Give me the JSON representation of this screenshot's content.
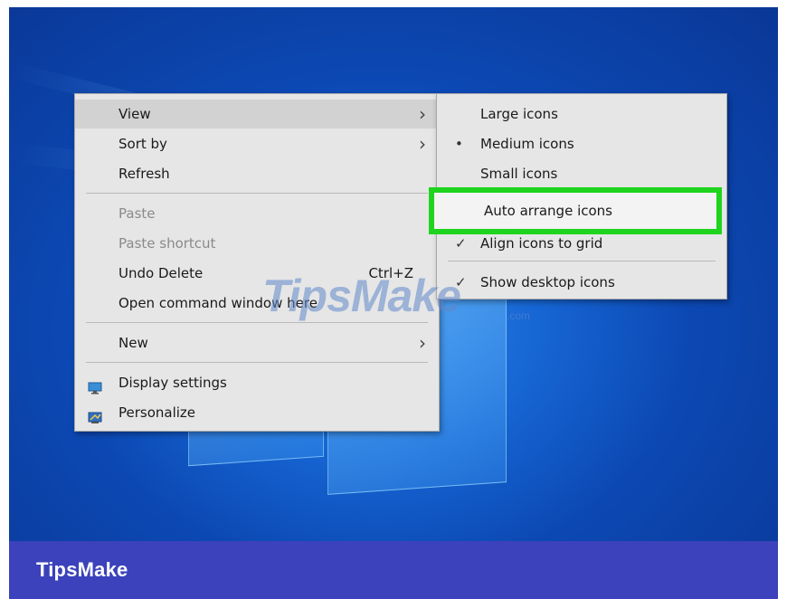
{
  "context_menu": {
    "items": [
      {
        "label": "View"
      },
      {
        "label": "Sort by"
      },
      {
        "label": "Refresh"
      },
      {
        "label": "Paste"
      },
      {
        "label": "Paste shortcut"
      },
      {
        "label": "Undo Delete",
        "shortcut": "Ctrl+Z"
      },
      {
        "label": "Open command window here"
      },
      {
        "label": "New"
      },
      {
        "label": "Display settings",
        "icon": "display-settings-icon"
      },
      {
        "label": "Personalize",
        "icon": "personalize-icon"
      }
    ]
  },
  "view_submenu": {
    "items": [
      {
        "label": "Large icons"
      },
      {
        "label": "Medium icons",
        "marker": "•"
      },
      {
        "label": "Small icons"
      },
      {
        "label": "Auto arrange icons"
      },
      {
        "label": "Align icons to grid",
        "marker": "✓"
      },
      {
        "label": "Show desktop icons",
        "marker": "✓"
      }
    ]
  },
  "highlight_color": "#1ed41e",
  "watermark": {
    "text": "TipsMake",
    "suffix": ".com"
  },
  "footer": {
    "brand": "TipsMake"
  }
}
